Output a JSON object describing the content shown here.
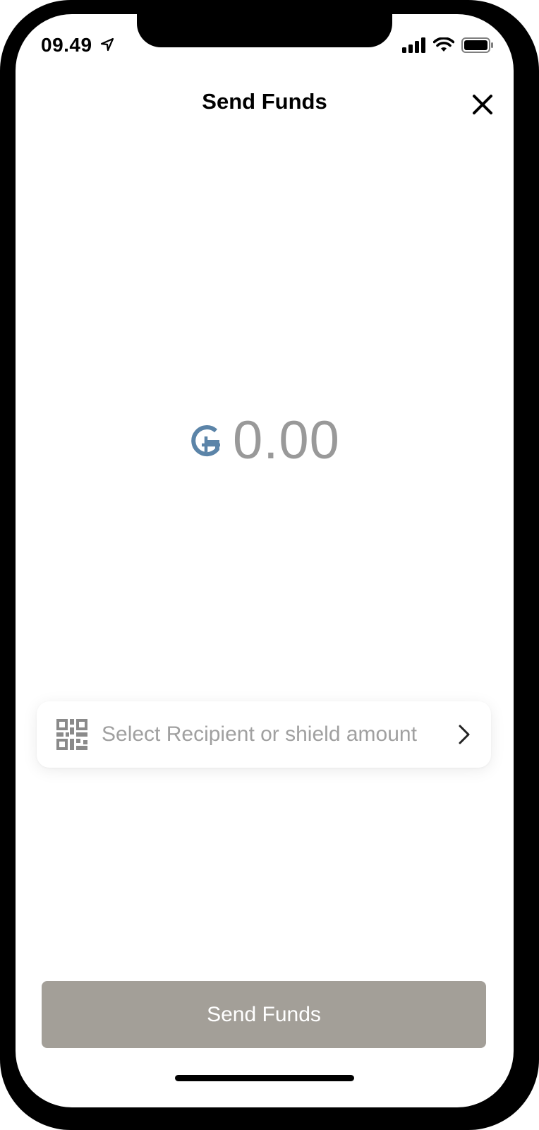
{
  "status_bar": {
    "time": "09.49",
    "icons": [
      "location-arrow-icon",
      "signal-bars-icon",
      "wifi-icon",
      "battery-icon"
    ]
  },
  "header": {
    "title": "Send Funds",
    "close_icon": "close-icon"
  },
  "amount": {
    "currency_icon": "currency-g-icon",
    "value": "0.00"
  },
  "recipient": {
    "icon": "qr-code-icon",
    "label": "Select Recipient or shield amount",
    "chevron_icon": "chevron-right-icon"
  },
  "send_button": {
    "label": "Send Funds"
  },
  "colors": {
    "accent": "#5b84a8",
    "amount_text": "#999999",
    "button_disabled": "#a39f98"
  }
}
